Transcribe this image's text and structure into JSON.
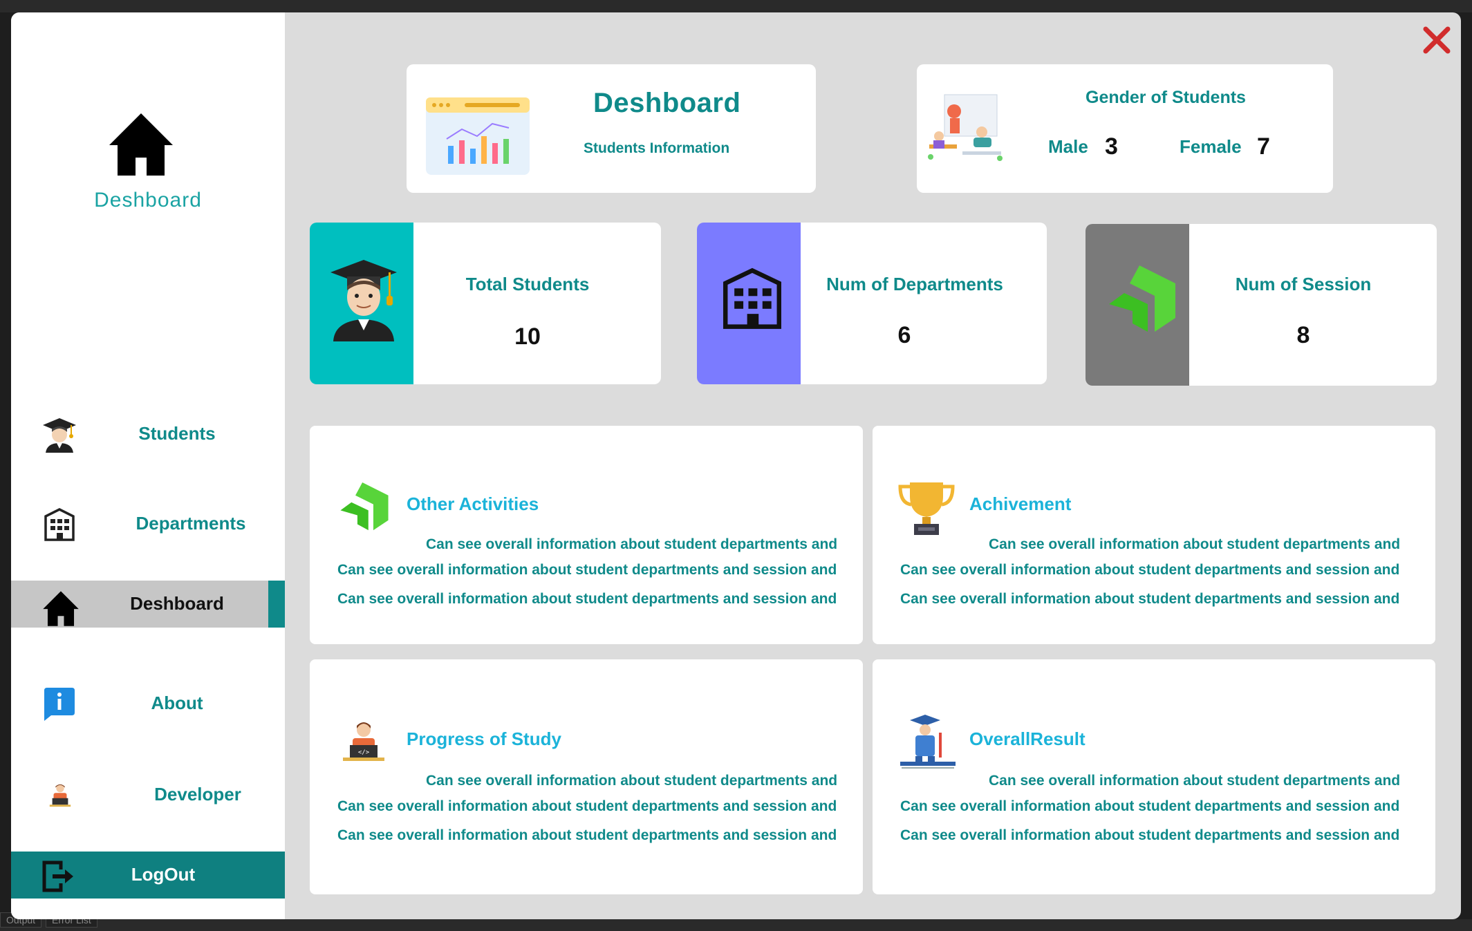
{
  "ghost": {
    "bottom_tab_1": "Output",
    "bottom_tab_2": "Error List"
  },
  "sidebar": {
    "brand_title": "Deshboard",
    "items": [
      {
        "label": "Students",
        "icon": "student-graduate-icon"
      },
      {
        "label": "Departments",
        "icon": "building-icon"
      },
      {
        "label": "Deshboard",
        "icon": "home-icon",
        "active": true
      },
      {
        "label": "About",
        "icon": "info-icon"
      },
      {
        "label": "Developer",
        "icon": "developer-icon"
      },
      {
        "label": "LogOut",
        "icon": "logout-icon"
      }
    ]
  },
  "header_card": {
    "title": "Deshboard",
    "subtitle": "Students Information"
  },
  "gender_card": {
    "title": "Gender of Students",
    "male_label": "Male",
    "male_value": "3",
    "female_label": "Female",
    "female_value": "7"
  },
  "stats": [
    {
      "label": "Total Students",
      "value": "10",
      "color": "#00bfbf",
      "icon": "student-graduate-icon"
    },
    {
      "label": "Num of Departments",
      "value": "6",
      "color": "#7b7bff",
      "icon": "building-icon"
    },
    {
      "label": "Num of Session",
      "value": "8",
      "color": "#7a7a7a",
      "icon": "session-arrows-icon"
    }
  ],
  "info_cards": [
    {
      "title": "Other Activities",
      "icon": "activities-arrows-icon",
      "lines": [
        "Can see overall information about student departments and",
        "Can see overall information about student departments and session and",
        "Can see overall information about student departments and session and"
      ]
    },
    {
      "title": "Achivement",
      "icon": "trophy-icon",
      "lines": [
        "Can see overall information about student departments and",
        "Can see overall information about student departments and session and",
        "Can see overall information about student departments and session and"
      ]
    },
    {
      "title": "Progress of Study",
      "icon": "coder-icon",
      "lines": [
        "Can see overall information about student departments and",
        "Can see overall information about student departments and session and",
        "Can see overall information about student departments and session and"
      ]
    },
    {
      "title": "OverallResult",
      "icon": "teacher-icon",
      "lines": [
        "Can see overall information about student departments and",
        "Can see overall information about student departments and session and",
        "Can see overall information about student departments and session and"
      ]
    }
  ],
  "colors": {
    "teal": "#0f8a8a",
    "accent_cyan": "#1bb3d9",
    "close_red": "#d12c2c"
  }
}
